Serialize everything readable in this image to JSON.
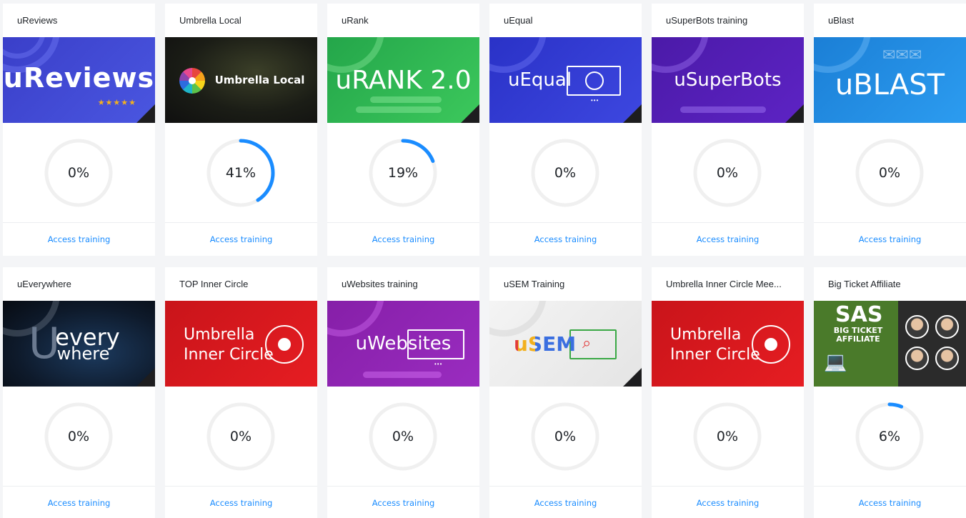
{
  "accent_color": "#1a8cff",
  "ring_track_color": "#f0f0f0",
  "cards": [
    {
      "title": "uReviews",
      "progress": "0%",
      "percent": 0,
      "cta": "Access training",
      "thumb_text": "uReviews",
      "thumb_extra": "★★★★★"
    },
    {
      "title": "Umbrella Local",
      "progress": "41%",
      "percent": 41,
      "cta": "Access training",
      "thumb_text": "Umbrella Local"
    },
    {
      "title": "uRank",
      "progress": "19%",
      "percent": 19,
      "cta": "Access training",
      "thumb_text": "uRANK 2.0"
    },
    {
      "title": "uEqual",
      "progress": "0%",
      "percent": 0,
      "cta": "Access training",
      "thumb_text": "uEqual"
    },
    {
      "title": "uSuperBots training",
      "progress": "0%",
      "percent": 0,
      "cta": "Access training",
      "thumb_text": "uSuperBots"
    },
    {
      "title": "uBlast",
      "progress": "0%",
      "percent": 0,
      "cta": "Access training",
      "thumb_text": "uBLAST"
    },
    {
      "title": "uEverywhere",
      "progress": "0%",
      "percent": 0,
      "cta": "Access training",
      "thumb_text": "every",
      "thumb_extra": "where"
    },
    {
      "title": "TOP Inner Circle",
      "progress": "0%",
      "percent": 0,
      "cta": "Access training",
      "thumb_text": "Umbrella",
      "thumb_extra": "Inner Circle"
    },
    {
      "title": "uWebsites training",
      "progress": "0%",
      "percent": 0,
      "cta": "Access training",
      "thumb_text": "uWebsites"
    },
    {
      "title": "uSEM Training",
      "progress": "0%",
      "percent": 0,
      "cta": "Access training",
      "thumb_text": "uSEM"
    },
    {
      "title": "Umbrella Inner Circle Mee...",
      "progress": "0%",
      "percent": 0,
      "cta": "Access training",
      "thumb_text": "Umbrella",
      "thumb_extra": "Inner Circle"
    },
    {
      "title": "Big Ticket Affiliate",
      "progress": "6%",
      "percent": 6,
      "cta": "Access training",
      "thumb_text": "SAS",
      "thumb_extra": "BIG TICKET AFFILIATE"
    }
  ]
}
